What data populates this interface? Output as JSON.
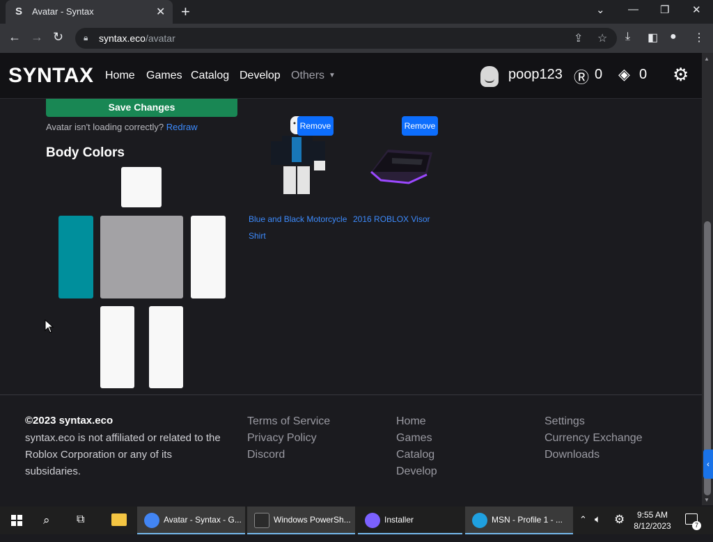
{
  "browser": {
    "tab_favicon": "S",
    "tab_title": "Avatar - Syntax",
    "url_domain": "syntax.eco",
    "url_path": "/avatar"
  },
  "nav": {
    "brand": "SYNTAX",
    "links": [
      "Home",
      "Games",
      "Catalog",
      "Develop"
    ],
    "others": "Others",
    "username": "poop123",
    "robux": "0",
    "tix": "0"
  },
  "avatar_panel": {
    "save_label": "Save Changes",
    "note": "Avatar isn't loading correctly?",
    "redraw": "Redraw",
    "body_colors_title": "Body Colors"
  },
  "body_colors": {
    "head": "#f8f8f8",
    "torso": "#a3a2a5",
    "left_arm": "#008f9c",
    "right_arm": "#f8f8f8",
    "left_leg": "#f8f8f8",
    "right_leg": "#f8f8f8"
  },
  "wearing": {
    "items": [
      {
        "name": "Blue and Black Motorcycle Shirt",
        "remove_label": "Remove"
      },
      {
        "name": "2016 ROBLOX Visor",
        "remove_label": "Remove"
      }
    ]
  },
  "footer": {
    "copyright": "©2023 syntax.eco",
    "disclaimer": "syntax.eco is not affiliated or related to the Roblox Corporation or any of its subsidaries.",
    "col1": [
      "Terms of Service",
      "Privacy Policy",
      "Discord"
    ],
    "col2": [
      "Home",
      "Games",
      "Catalog",
      "Develop"
    ],
    "col3": [
      "Settings",
      "Currency Exchange",
      "Downloads"
    ]
  },
  "taskbar": {
    "apps": [
      {
        "label": "Avatar - Syntax - G...",
        "icon": "chrome-icon",
        "color": "#4285f4"
      },
      {
        "label": "Windows PowerSh...",
        "icon": "powershell-icon",
        "color": "#2b2b2b"
      },
      {
        "label": "Installer",
        "icon": "installer-icon",
        "color": "#7b61ff"
      },
      {
        "label": "MSN - Profile 1 - ...",
        "icon": "edge-icon",
        "color": "#1fa0e0"
      }
    ],
    "time": "9:55 AM",
    "date": "8/12/2023",
    "notifications": "7"
  }
}
